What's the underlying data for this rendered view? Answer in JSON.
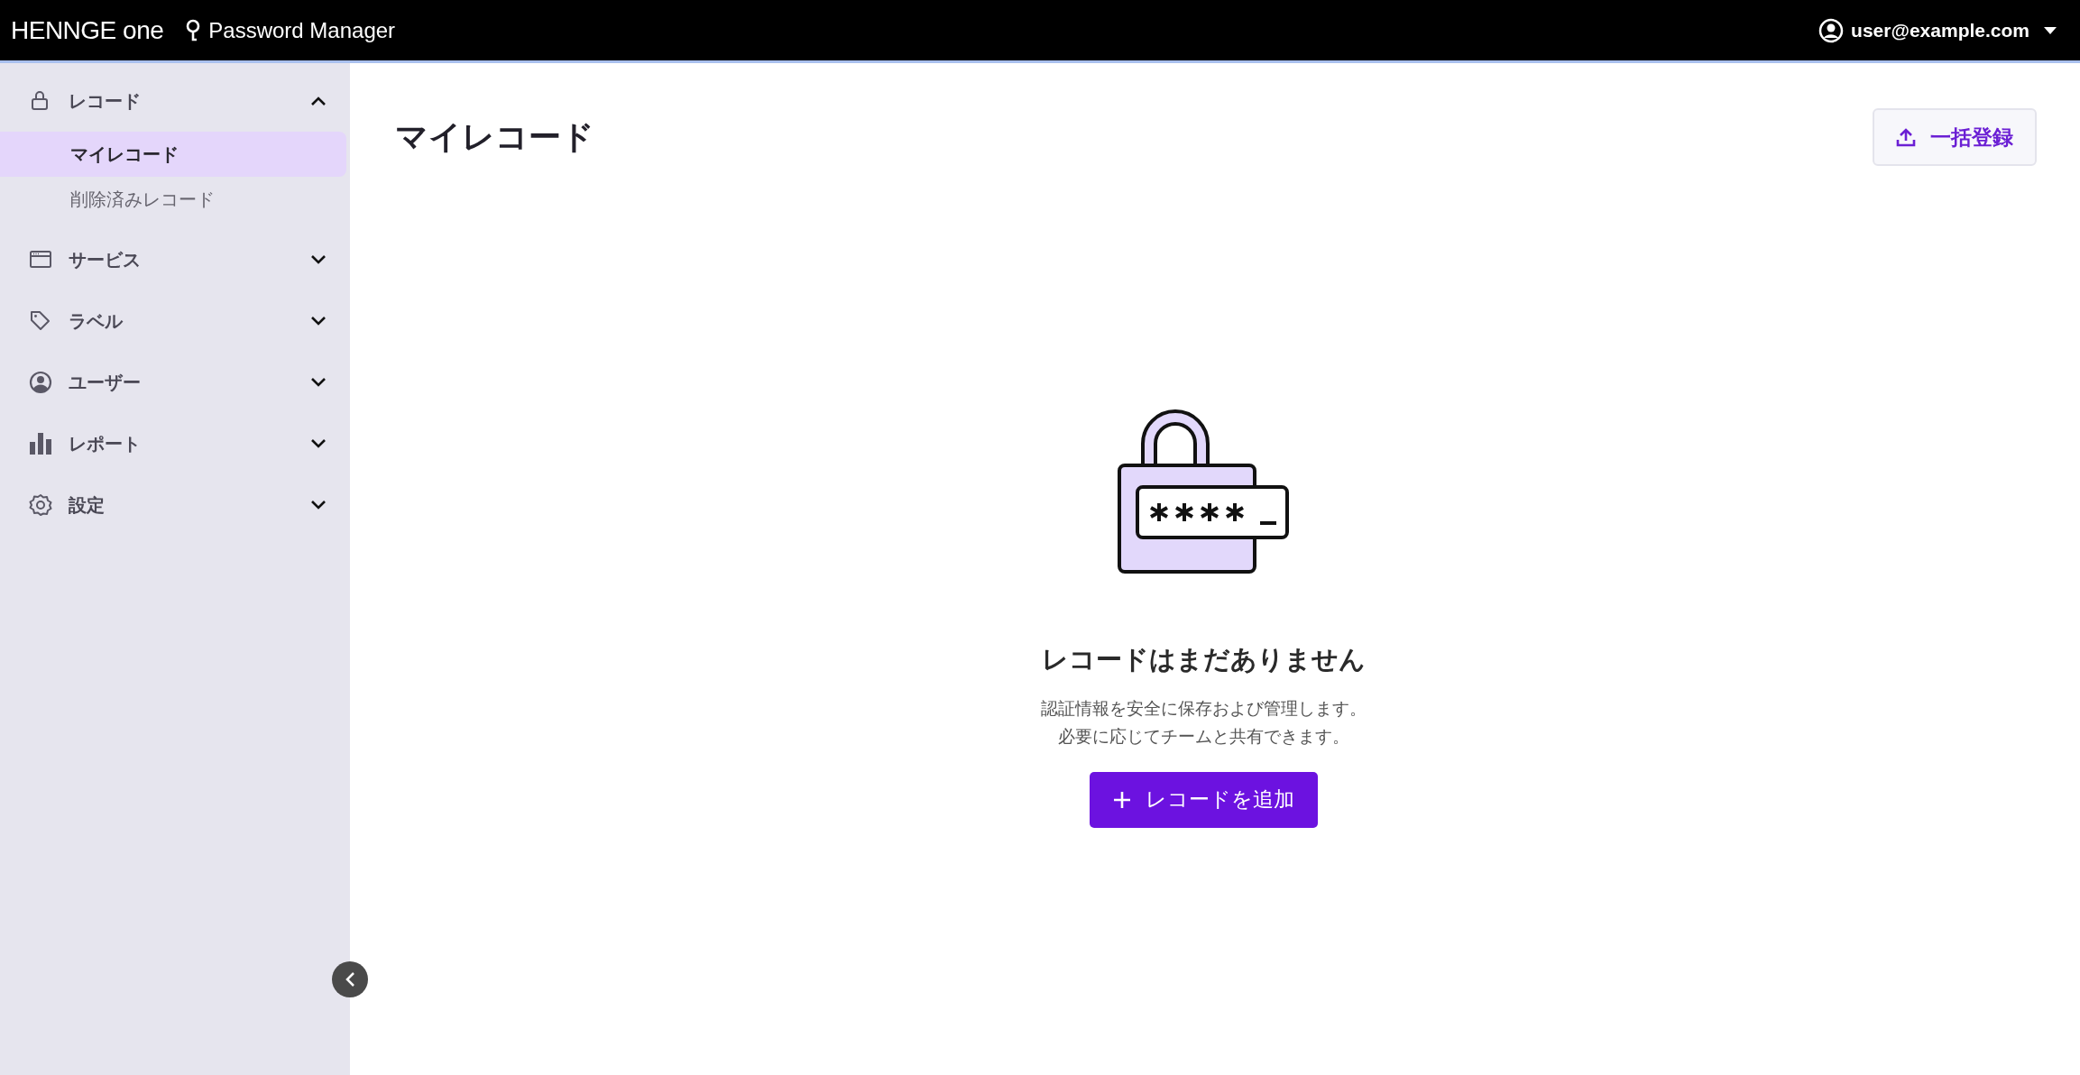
{
  "topbar": {
    "logo": "HENNGE one",
    "product": "Password Manager",
    "user": "user@example.com"
  },
  "sidebar": {
    "sections": [
      {
        "label": "レコード",
        "expanded": true,
        "children": [
          {
            "label": "マイレコード",
            "selected": true
          },
          {
            "label": "削除済みレコード",
            "selected": false
          }
        ]
      },
      {
        "label": "サービス",
        "expanded": false
      },
      {
        "label": "ラベル",
        "expanded": false
      },
      {
        "label": "ユーザー",
        "expanded": false
      },
      {
        "label": "レポート",
        "expanded": false
      },
      {
        "label": "設定",
        "expanded": false
      }
    ],
    "collapsed": false
  },
  "main": {
    "title": "マイレコード",
    "bulk_button": "一括登録",
    "empty_state": {
      "heading": "レコードはまだありません",
      "description": [
        "認証情報を安全に保存および管理します。",
        "必要に応じてチームと共有できます。"
      ],
      "add_button": "レコードを追加"
    }
  }
}
